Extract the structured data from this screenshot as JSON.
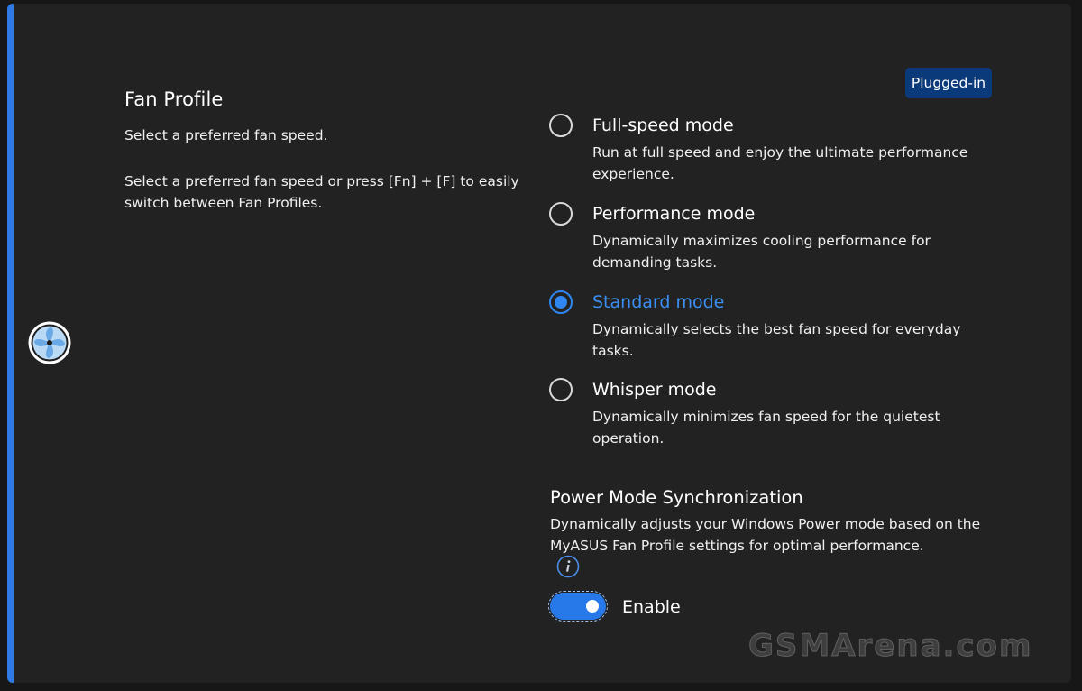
{
  "fan_profile": {
    "title": "Fan Profile",
    "subtitle": "Select a preferred fan speed.",
    "hint": "Select a preferred fan speed or press [Fn] + [F]  to easily switch between Fan Profiles.",
    "icon": "fan-icon"
  },
  "power_source_badge": "Plugged-in",
  "modes": [
    {
      "label": "Full-speed mode",
      "description": "Run at full speed and enjoy the ultimate performance experience.",
      "selected": false
    },
    {
      "label": "Performance mode",
      "description": "Dynamically maximizes cooling performance for demanding tasks.",
      "selected": false
    },
    {
      "label": "Standard mode",
      "description": "Dynamically selects the best fan speed for everyday tasks.",
      "selected": true
    },
    {
      "label": "Whisper mode",
      "description": "Dynamically minimizes fan speed for the quietest operation.",
      "selected": false
    }
  ],
  "power_mode_sync": {
    "title": "Power Mode Synchronization",
    "description": "Dynamically adjusts your Windows Power mode based on the MyASUS Fan Profile settings for optimal performance.",
    "info_icon": "info-icon",
    "toggle_label": "Enable",
    "enabled": true
  },
  "watermark": "GSMArena.com",
  "colors": {
    "accent": "#2f86f0",
    "background": "#222222",
    "badge": "#0b3a7a"
  }
}
